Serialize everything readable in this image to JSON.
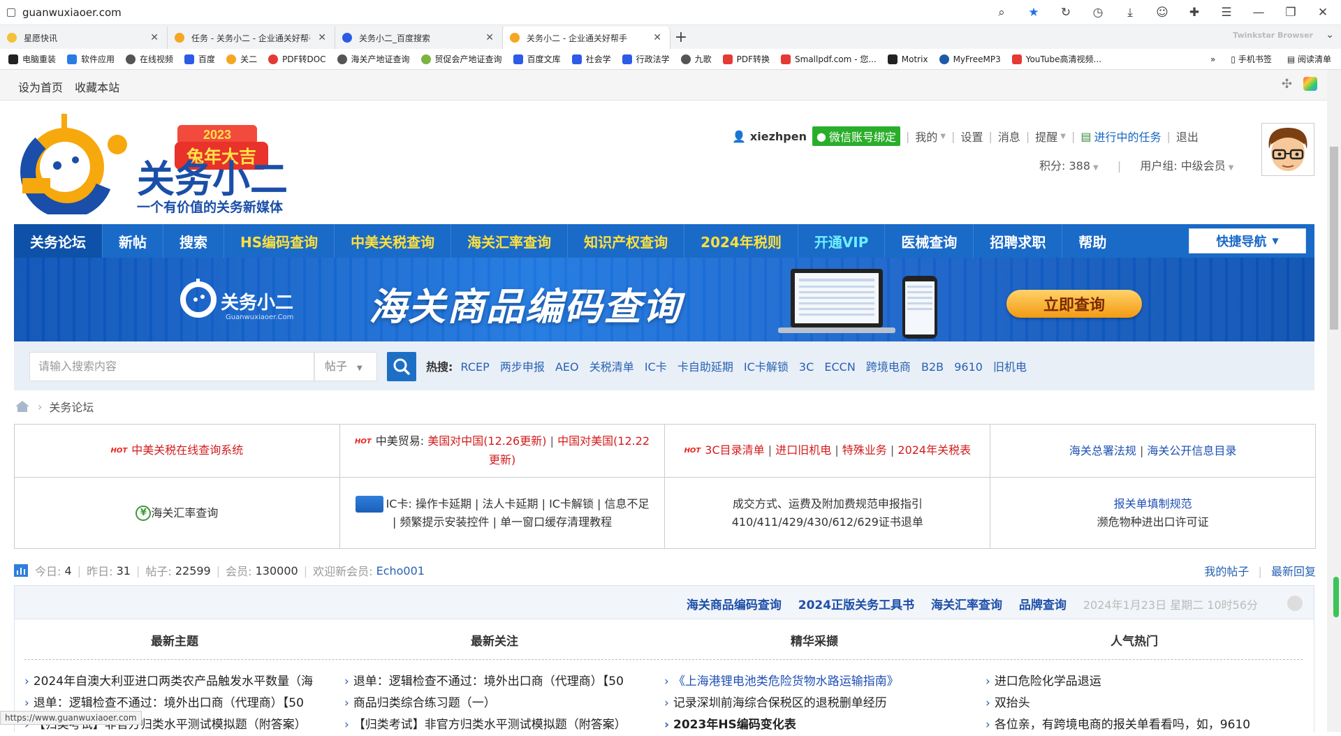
{
  "browser": {
    "url": "guanwuxiaoer.com",
    "tabs": [
      {
        "title": "星愿快讯",
        "color": "#f3c13a"
      },
      {
        "title": "任务 - 关务小二 - 企业通关好帮手",
        "color": "#f5a623"
      },
      {
        "title": "关务小二_百度搜索",
        "color": "#2c5be8"
      },
      {
        "title": "关务小二 - 企业通关好帮手",
        "color": "#f5a623"
      }
    ],
    "brand": "Twinkstar Browser",
    "bookmarks": [
      {
        "label": "电脑重装",
        "color": "#222"
      },
      {
        "label": "软件应用",
        "color": "#2a7be4"
      },
      {
        "label": "在线视频",
        "color": "#555"
      },
      {
        "label": "百度",
        "color": "#2c5be8"
      },
      {
        "label": "关二",
        "color": "#f5a623"
      },
      {
        "label": "PDF转DOC",
        "color": "#e53935"
      },
      {
        "label": "海关产地证查询",
        "color": "#555"
      },
      {
        "label": "贸促会产地证查询",
        "color": "#7cb342"
      },
      {
        "label": "百度文库",
        "color": "#2c5be8"
      },
      {
        "label": "社会学",
        "color": "#2c5be8"
      },
      {
        "label": "行政法学",
        "color": "#2c5be8"
      },
      {
        "label": "九歌",
        "color": "#555"
      },
      {
        "label": "PDF转换",
        "color": "#e53935"
      },
      {
        "label": "Smallpdf.com - 您...",
        "color": "#e53935"
      },
      {
        "label": "Motrix",
        "color": "#222"
      },
      {
        "label": "MyFreeMP3",
        "color": "#1e5aa8"
      },
      {
        "label": "YouTube高清视频...",
        "color": "#e53935"
      }
    ],
    "bookmark_right": [
      "手机书签",
      "阅读清单"
    ],
    "status_url": "https://www.guanwuxiaoer.com"
  },
  "topbar": {
    "links": [
      "设为首页",
      "收藏本站"
    ]
  },
  "logo": {
    "badge": "2023",
    "slogan_badge": "兔年大吉",
    "name": "关务小二",
    "tagline": "一个有价值的关务新媒体"
  },
  "user": {
    "name": "xiezhpen",
    "wechat": "微信账号绑定",
    "menu": [
      "我的",
      "设置",
      "消息",
      "提醒"
    ],
    "tasks": "进行中的任务",
    "logout": "退出",
    "points": "积分: 388",
    "group": "用户组: 中级会员"
  },
  "nav": {
    "items": [
      {
        "label": "关务论坛",
        "style": "active"
      },
      {
        "label": "新帖",
        "style": ""
      },
      {
        "label": "搜索",
        "style": ""
      },
      {
        "label": "HS编码查询",
        "style": "yellow"
      },
      {
        "label": "中美关税查询",
        "style": "yellow"
      },
      {
        "label": "海关汇率查询",
        "style": "yellow"
      },
      {
        "label": "知识产权查询",
        "style": "yellow"
      },
      {
        "label": "2024年税则",
        "style": "yellow"
      },
      {
        "label": "开通VIP",
        "style": "cyan"
      },
      {
        "label": "医械查询",
        "style": ""
      },
      {
        "label": "招聘求职",
        "style": ""
      },
      {
        "label": "帮助",
        "style": ""
      }
    ],
    "quick_nav": "快捷导航"
  },
  "banner": {
    "logo_text": "关务小二",
    "logo_sub": "Guanwuxiaoer.Com",
    "title": "海关商品编码查询",
    "button": "立即查询"
  },
  "search": {
    "placeholder": "请输入搜索内容",
    "type": "帖子",
    "hot_label": "热搜:",
    "hot": [
      "RCEP",
      "两步申报",
      "AEO",
      "关税清单",
      "IC卡",
      "卡自助延期",
      "IC卡解锁",
      "3C",
      "ECCN",
      "跨境电商",
      "B2B",
      "9610",
      "旧机电"
    ]
  },
  "breadcrumb": {
    "label": "关务论坛"
  },
  "links_table": {
    "r1c1": "中美关税在线查询系统",
    "r1c2_prefix": "中美贸易:",
    "r1c2_a": "美国对中国(12.26更新)",
    "r1c2_b": "中国对美国(12.22更新)",
    "r1c3_a": "3C目录清单",
    "r1c3_b": "进口旧机电",
    "r1c3_c": "特殊业务",
    "r1c3_d": "2024年关税表",
    "r1c4_a": "海关总署法规",
    "r1c4_b": "海关公开信息目录",
    "r2c1": "海关汇率查询",
    "r2c2": "IC卡: 操作卡延期 | 法人卡延期 | IC卡解锁 | 信息不足 | 频繁提示安装控件 | 单一窗口缓存清理教程",
    "r2c3_a": "成交方式、运费及附加费规范申报指引",
    "r2c3_b": "410/411/429/430/612/629证书退单",
    "r2c4_a": "报关单填制规范",
    "r2c4_b": "濒危物种进出口许可证"
  },
  "stats": {
    "today_label": "今日:",
    "today": "4",
    "yesterday_label": "昨日:",
    "yesterday": "31",
    "posts_label": "帖子:",
    "posts": "22599",
    "members_label": "会员:",
    "members": "130000",
    "welcome_label": "欢迎新会员:",
    "newest": "Echo001",
    "my_posts": "我的帖子",
    "latest_reply": "最新回复"
  },
  "panel": {
    "links": [
      "海关商品编码查询",
      "2024正版关务工具书",
      "海关汇率查询",
      "品牌查询"
    ],
    "date": "2024年1月23日 星期二 10时56分",
    "columns": [
      {
        "title": "最新主题",
        "items": [
          "2024年自澳大利亚进口两类农产品触发水平数量（海",
          "退单：逻辑检查不通过：境外出口商（代理商）【50",
          "【归类考试】非官方归类水平测试模拟题（附答案）"
        ]
      },
      {
        "title": "最新关注",
        "items": [
          "退单：逻辑检查不通过：境外出口商（代理商）【50",
          "商品归类综合练习题（一）",
          "【归类考试】非官方归类水平测试模拟题（附答案）"
        ]
      },
      {
        "title": "精华采撷",
        "items": [
          "《上海港锂电池类危险货物水路运输指南》",
          "记录深圳前海综合保税区的退税删单经历",
          "2023年HS编码变化表"
        ]
      },
      {
        "title": "人气热门",
        "items": [
          "进口危险化学品退运",
          "双抬头",
          "各位亲，有跨境电商的报关单看看吗，如，9610"
        ]
      }
    ]
  }
}
